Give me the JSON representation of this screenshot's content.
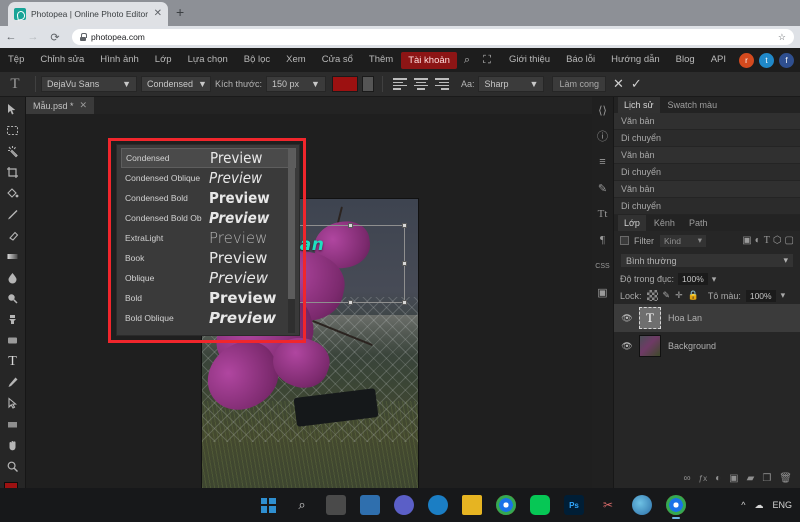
{
  "browser": {
    "tab_title": "Photopea | Online Photo Editor",
    "tab_close": "✕",
    "new_tab": "+",
    "back": "←",
    "forward": "→",
    "reload": "⟳",
    "url": "photopea.com",
    "star": "☆",
    "menu": "⋮",
    "profile": "●"
  },
  "menubar": {
    "items": [
      {
        "label": "Tệp"
      },
      {
        "label": "Chỉnh sửa"
      },
      {
        "label": "Hình ảnh"
      },
      {
        "label": "Lớp"
      },
      {
        "label": "Lựa chọn"
      },
      {
        "label": "Bộ lọc"
      },
      {
        "label": "Xem"
      },
      {
        "label": "Cửa sổ"
      },
      {
        "label": "Thêm"
      }
    ],
    "account": "Tài khoản",
    "search_icon": "⌕",
    "fullscreen_icon": "⛶",
    "right_links": [
      {
        "label": "Giới thiệu"
      },
      {
        "label": "Báo lỗi"
      },
      {
        "label": "Hướng dẫn"
      },
      {
        "label": "Blog"
      },
      {
        "label": "API"
      }
    ],
    "social": [
      {
        "name": "reddit-icon",
        "glyph": "r"
      },
      {
        "name": "twitter-icon",
        "glyph": "t"
      },
      {
        "name": "facebook-icon",
        "glyph": "f"
      }
    ]
  },
  "options_bar": {
    "tool_glyph": "T",
    "font_family": "DejaVu Sans",
    "font_style": "Condensed",
    "size_label": "Kích thước:",
    "size_value": "150 px",
    "caret": "▼",
    "antialias_label": "Aa:",
    "antialias_value": "Sharp",
    "warp_label": "Làm cong",
    "cancel_glyph": "✕",
    "commit_glyph": "✓",
    "fg_color": "#9c1111",
    "bg_color": "#555555"
  },
  "doc_tab": {
    "name": "Mẫu.psd *",
    "close": "✕"
  },
  "canvas": {
    "text_layer_content": "Lan"
  },
  "font_dropdown": {
    "highlight_color": "#f0262c",
    "preview_word": "Preview",
    "items": [
      {
        "name": "Condensed",
        "selected": true
      },
      {
        "name": "Condensed Oblique",
        "selected": false
      },
      {
        "name": "Condensed Bold",
        "selected": false
      },
      {
        "name": "Condensed Bold Ob",
        "selected": false
      },
      {
        "name": "ExtraLight",
        "selected": false
      },
      {
        "name": "Book",
        "selected": false
      },
      {
        "name": "Oblique",
        "selected": false
      },
      {
        "name": "Bold",
        "selected": false
      },
      {
        "name": "Bold Oblique",
        "selected": false
      }
    ]
  },
  "left_tools": [
    {
      "name": "move-tool"
    },
    {
      "name": "marquee-select-tool"
    },
    {
      "name": "magic-wand-tool"
    },
    {
      "name": "crop-tool"
    },
    {
      "name": "paint-bucket-tool"
    },
    {
      "name": "eyedropper-tool"
    },
    {
      "name": "eraser-tool"
    },
    {
      "name": "gradient-tool"
    },
    {
      "name": "blur-tool"
    },
    {
      "name": "dodge-tool"
    },
    {
      "name": "clone-stamp-tool"
    },
    {
      "name": "shape-tool"
    },
    {
      "name": "type-tool"
    },
    {
      "name": "pen-tool"
    },
    {
      "name": "path-select-tool"
    },
    {
      "name": "rectangle-tool"
    },
    {
      "name": "hand-tool"
    },
    {
      "name": "zoom-tool"
    }
  ],
  "right_dock": {
    "icons": [
      {
        "name": "code-icon",
        "glyph": "⟨⟩"
      },
      {
        "name": "info-icon",
        "glyph": "ⓘ"
      },
      {
        "name": "histogram-icon",
        "glyph": "≡"
      },
      {
        "name": "brush-icon",
        "glyph": "✎"
      },
      {
        "name": "character-icon",
        "glyph": "Tt"
      },
      {
        "name": "paragraph-icon",
        "glyph": "¶"
      },
      {
        "name": "css-icon",
        "glyph": "CSS"
      },
      {
        "name": "image-icon",
        "glyph": "▣"
      }
    ],
    "history_panel": {
      "tabs": [
        {
          "label": "Lịch sử",
          "active": true
        },
        {
          "label": "Swatch màu",
          "active": false
        }
      ],
      "entries": [
        {
          "label": "Văn bản"
        },
        {
          "label": "Di chuyển"
        },
        {
          "label": "Văn bản"
        },
        {
          "label": "Di chuyển"
        },
        {
          "label": "Văn bản"
        },
        {
          "label": "Di chuyển"
        }
      ]
    },
    "layers_panel": {
      "tabs": [
        {
          "label": "Lớp",
          "active": true
        },
        {
          "label": "Kênh",
          "active": false
        },
        {
          "label": "Path",
          "active": false
        }
      ],
      "filter_label": "Filter",
      "kind_label": "Kind",
      "blend_mode": "Bình thường",
      "opacity_label": "Độ trong đục:",
      "opacity_value": "100%",
      "lock_label": "Lock:",
      "fill_label": "Tô màu:",
      "fill_value": "100%",
      "layers": [
        {
          "name": "Hoa Lan",
          "kind": "text",
          "selected": true,
          "visible": true
        },
        {
          "name": "Background",
          "kind": "image",
          "selected": false,
          "visible": true
        }
      ],
      "bottom_icons": [
        {
          "name": "link-layers-icon",
          "glyph": "∞"
        },
        {
          "name": "layer-effects-icon",
          "glyph": "ƒx"
        },
        {
          "name": "adjustment-layer-icon",
          "glyph": "◐"
        },
        {
          "name": "layer-mask-icon",
          "glyph": "▣"
        },
        {
          "name": "new-group-icon",
          "glyph": "▰"
        },
        {
          "name": "new-layer-icon",
          "glyph": "❐"
        },
        {
          "name": "delete-layer-icon",
          "glyph": "🗑"
        }
      ]
    }
  },
  "taskbar": {
    "items": [
      {
        "name": "start-button",
        "glyph": ""
      },
      {
        "name": "search-icon",
        "glyph": "⌕"
      },
      {
        "name": "task-view-icon",
        "glyph": "❐"
      },
      {
        "name": "widgets-icon",
        "glyph": "▤"
      },
      {
        "name": "teams-icon",
        "glyph": "▣"
      },
      {
        "name": "edge-icon",
        "glyph": "e"
      },
      {
        "name": "file-explorer-icon",
        "glyph": "▰"
      },
      {
        "name": "chrome-icon",
        "glyph": "◉"
      },
      {
        "name": "line-icon",
        "glyph": "▭"
      },
      {
        "name": "photoshop-icon",
        "glyph": "Ps"
      },
      {
        "name": "snipping-tool-icon",
        "glyph": "✂"
      },
      {
        "name": "paint-icon",
        "glyph": "🎨"
      },
      {
        "name": "chrome-active-icon",
        "glyph": "◉"
      }
    ],
    "tray_chevron": "^",
    "tray_cloud": "☁",
    "language": "ENG"
  }
}
